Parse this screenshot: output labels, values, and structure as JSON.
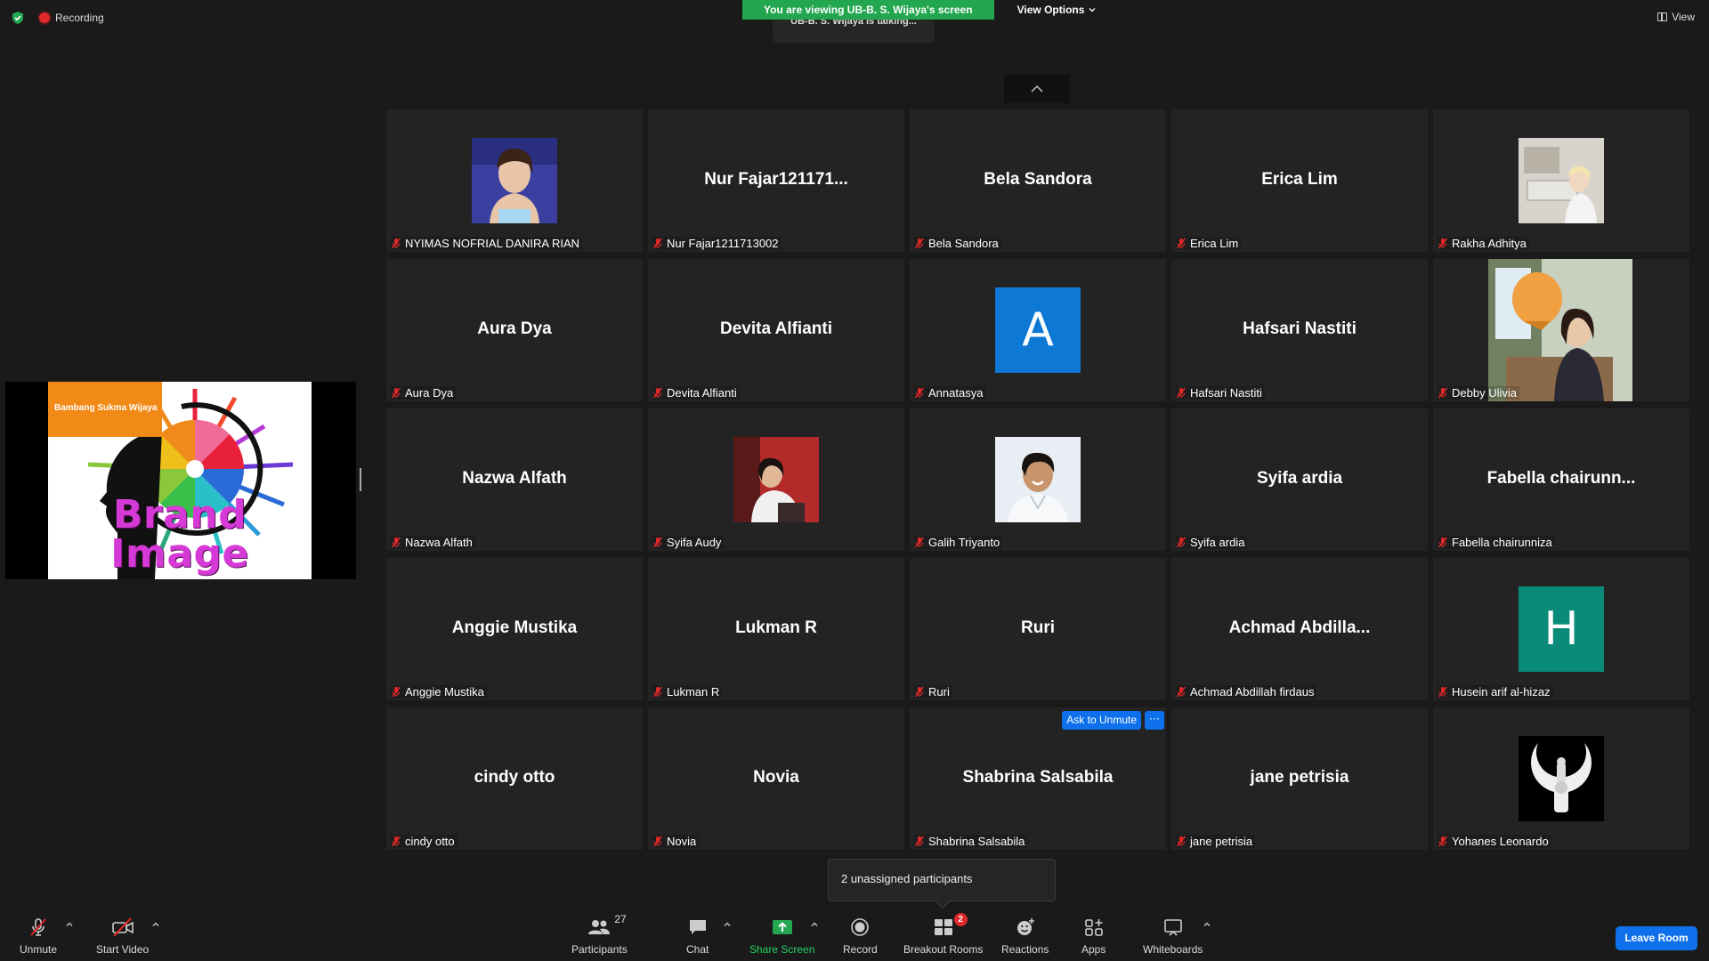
{
  "top": {
    "recording_label": "Recording",
    "viewing_banner": "You are viewing UB-B. S. Wijaya's screen",
    "view_options_label": "View Options",
    "talking_label": "UB-B. S. Wijaya is talking...",
    "view_label": "View"
  },
  "share": {
    "org_text": "Bambang Sukma Wijaya",
    "title_text": "Brand Image"
  },
  "tiles": [
    {
      "label": "NYIMAS NOFRIAL DANIRA RIAN",
      "kind": "photo"
    },
    {
      "label": "Nur Fajar1211713002",
      "name": "Nur  Fajar121171...",
      "kind": "name"
    },
    {
      "label": "Bela Sandora",
      "name": "Bela Sandora",
      "kind": "name"
    },
    {
      "label": "Erica Lim",
      "name": "Erica Lim",
      "kind": "name"
    },
    {
      "label": "Rakha Adhitya",
      "kind": "photo"
    },
    {
      "label": "Aura Dya",
      "name": "Aura Dya",
      "kind": "name"
    },
    {
      "label": "Devita Alfianti",
      "name": "Devita Alfianti",
      "kind": "name"
    },
    {
      "label": "Annatasya",
      "letter": "A",
      "kind": "letter"
    },
    {
      "label": "Hafsari Nastiti",
      "name": "Hafsari Nastiti",
      "kind": "name"
    },
    {
      "label": "Debby Ulivia",
      "kind": "photo"
    },
    {
      "label": "Nazwa Alfath",
      "name": "Nazwa Alfath",
      "kind": "name"
    },
    {
      "label": "Syifa Audy",
      "kind": "photo"
    },
    {
      "label": "Galih Triyanto",
      "kind": "photo"
    },
    {
      "label": "Syifa ardia",
      "name": "Syifa ardia",
      "kind": "name"
    },
    {
      "label": "Fabella chairunniza",
      "name": "Fabella  chairunn...",
      "kind": "name"
    },
    {
      "label": "Anggie Mustika",
      "name": "Anggie Mustika",
      "kind": "name"
    },
    {
      "label": "Lukman R",
      "name": "Lukman R",
      "kind": "name"
    },
    {
      "label": "Ruri",
      "name": "Ruri",
      "kind": "name"
    },
    {
      "label": "Achmad Abdillah firdaus",
      "name": "Achmad  Abdilla...",
      "kind": "name"
    },
    {
      "label": "Husein arif al-hizaz",
      "letter": "H",
      "kind": "letter"
    },
    {
      "label": "cindy otto",
      "name": "cindy otto",
      "kind": "name"
    },
    {
      "label": "Novia",
      "name": "Novia",
      "kind": "name"
    },
    {
      "label": "Shabrina Salsabila",
      "name": "Shabrina Salsabila",
      "kind": "name",
      "ask_to_unmute": "Ask to Unmute",
      "more": "···"
    },
    {
      "label": "jane petrisia",
      "name": "jane petrisia",
      "kind": "name"
    },
    {
      "label": "Yohanes Leonardo",
      "kind": "photo"
    }
  ],
  "popup": {
    "text": "2 unassigned participants"
  },
  "toolbar": {
    "unmute": "Unmute",
    "start_video": "Start Video",
    "participants": "Participants",
    "participants_count": "27",
    "chat": "Chat",
    "share_screen": "Share Screen",
    "record": "Record",
    "breakout_rooms": "Breakout Rooms",
    "breakout_badge": "2",
    "reactions": "Reactions",
    "apps": "Apps",
    "whiteboards": "Whiteboards",
    "leave_room": "Leave Room"
  },
  "colors": {
    "accent_blue": "#0e71eb",
    "banner_green": "#23a650",
    "avatar_A": "#0e78d5",
    "avatar_H": "#0a8a78",
    "recording_red": "#e02828"
  }
}
